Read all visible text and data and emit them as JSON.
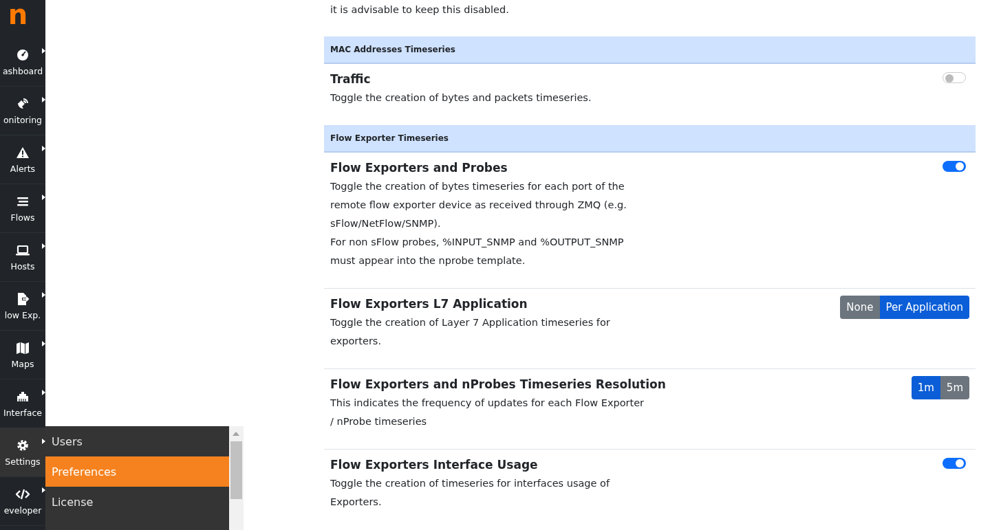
{
  "sidebar": {
    "logo": "n",
    "items": [
      {
        "label": "ashboard",
        "selected": false
      },
      {
        "label": "onitoring",
        "selected": false
      },
      {
        "label": "Alerts",
        "selected": false
      },
      {
        "label": "Flows",
        "selected": false
      },
      {
        "label": "Hosts",
        "selected": false
      },
      {
        "label": "low Exp.",
        "selected": false
      },
      {
        "label": "Maps",
        "selected": false
      },
      {
        "label": "Interface",
        "selected": false
      },
      {
        "label": "Settings",
        "selected": true
      },
      {
        "label": "eveloper",
        "selected": false
      }
    ]
  },
  "submenu": {
    "items": [
      {
        "label": "Users",
        "selected": false
      },
      {
        "label": "Preferences",
        "selected": true
      },
      {
        "label": "License",
        "selected": false
      }
    ]
  },
  "intro": "it is advisable to keep this disabled.",
  "sections": [
    {
      "title": "MAC Addresses Timeseries",
      "settings": [
        {
          "kind": "toggle",
          "title": "Traffic",
          "description": [
            "Toggle the creation of bytes and packets timeseries."
          ],
          "on": false
        }
      ]
    },
    {
      "title": "Flow Exporter Timeseries",
      "settings": [
        {
          "kind": "toggle",
          "title": "Flow Exporters and Probes",
          "description": [
            "Toggle the creation of bytes timeseries for each port of the remote flow exporter device as received through ZMQ (e.g. sFlow/NetFlow/SNMP).",
            "For non sFlow probes, %INPUT_SNMP and %OUTPUT_SNMP must appear into the nprobe template."
          ],
          "on": true
        },
        {
          "kind": "choice",
          "title": "Flow Exporters L7 Application",
          "description": [
            "Toggle the creation of Layer 7 Application timeseries for exporters."
          ],
          "options": [
            {
              "label": "None",
              "selected": false
            },
            {
              "label": "Per Application",
              "selected": true
            }
          ]
        },
        {
          "kind": "choice",
          "title": "Flow Exporters and nProbes Timeseries Resolution",
          "description": [
            "This indicates the frequency of updates for each Flow Exporter / nProbe timeseries"
          ],
          "options": [
            {
              "label": "1m",
              "selected": true
            },
            {
              "label": "5m",
              "selected": false
            }
          ]
        },
        {
          "kind": "toggle",
          "title": "Flow Exporters Interface Usage",
          "description": [
            "Toggle the creation of timeseries for interfaces usage of Exporters."
          ],
          "on": true
        }
      ]
    }
  ]
}
